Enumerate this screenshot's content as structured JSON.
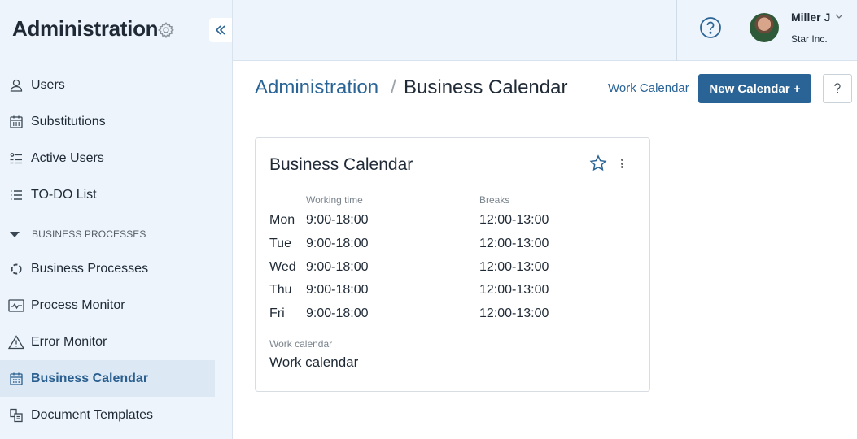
{
  "sidebar": {
    "title": "Administration",
    "items": [
      {
        "label": "Users"
      },
      {
        "label": "Substitutions"
      },
      {
        "label": "Active Users"
      },
      {
        "label": "TO-DO List"
      }
    ],
    "section_label": "BUSINESS PROCESSES",
    "section_items": [
      {
        "label": "Business Processes"
      },
      {
        "label": "Process Monitor"
      },
      {
        "label": "Error Monitor"
      },
      {
        "label": "Business Calendar"
      },
      {
        "label": "Document Templates"
      }
    ]
  },
  "topbar": {
    "user_name": "Miller J",
    "user_company": "Star Inc."
  },
  "header": {
    "breadcrumb_root": "Administration",
    "breadcrumb_separator": "/",
    "breadcrumb_current": "Business Calendar",
    "work_calendar_link": "Work Calendar",
    "new_calendar_button": "New Calendar +"
  },
  "card": {
    "title": "Business Calendar",
    "col_working_time": "Working time",
    "col_breaks": "Breaks",
    "rows": [
      {
        "day": "Mon",
        "working_time": "9:00-18:00",
        "breaks": "12:00-13:00"
      },
      {
        "day": "Tue",
        "working_time": "9:00-18:00",
        "breaks": "12:00-13:00"
      },
      {
        "day": "Wed",
        "working_time": "9:00-18:00",
        "breaks": "12:00-13:00"
      },
      {
        "day": "Thu",
        "working_time": "9:00-18:00",
        "breaks": "12:00-13:00"
      },
      {
        "day": "Fri",
        "working_time": "9:00-18:00",
        "breaks": "12:00-13:00"
      }
    ],
    "work_calendar_label": "Work calendar",
    "work_calendar_value": "Work calendar"
  },
  "colors": {
    "accent": "#2a6496",
    "sidebar_bg": "#edf4fb",
    "active_item_bg": "#dce8f4"
  }
}
